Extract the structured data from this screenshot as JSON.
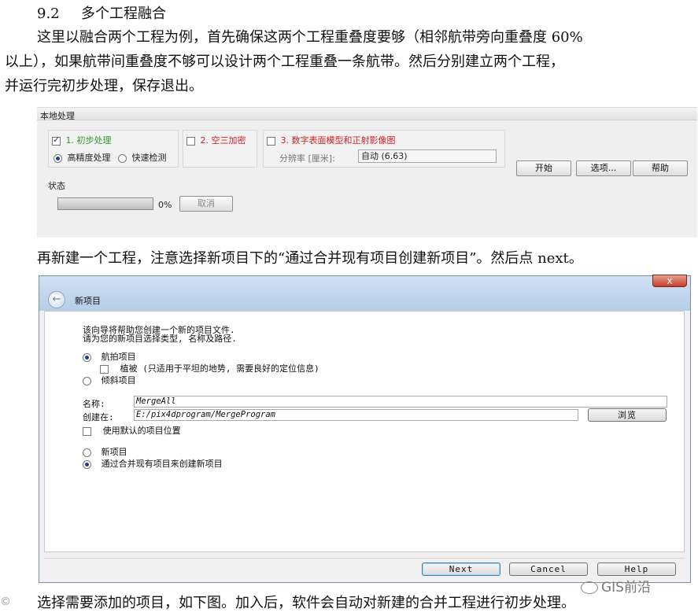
{
  "doc": {
    "heading_num": "9.2",
    "heading_text": "多个工程融合",
    "p1_line1": "这里以融合两个工程为例，首先确保这两个工程重叠度要够（相邻航带旁向重叠度 60%",
    "p1_line2": "以上），如果航带间重叠度不够可以设计两个工程重叠一条航带。然后分别建立两个工程，",
    "p1_line3": "并运行完初步处理，保存退出。",
    "p2": "再新建一个工程，注意选择新项目下的“通过合并现有项目创建新项目”。然后点 next。",
    "p3": "选择需要添加的项目，如下图。加入后，软件会自动对新建的合并工程进行初步处理。"
  },
  "local_processing": {
    "title": "本地处理",
    "step1_label": "1. 初步处理",
    "step1_checked": true,
    "mode_high": "高精度处理",
    "mode_fast": "快速检测",
    "mode_selected": "high",
    "step2_label": "2. 空三加密",
    "step2_checked": false,
    "step3_label": "3. 数字表面模型和正射影像图",
    "step3_checked": false,
    "resolution_label": "分辨率 [厘米]:",
    "resolution_value": "自动 (6.63)",
    "start_button": "开始",
    "options_button": "选项...",
    "help_button": "帮助",
    "status_label": "状态",
    "progress_text": "0%",
    "progress_value": 0,
    "cancel_button": "取消"
  },
  "new_project": {
    "title": "新项目",
    "close_symbol": "x",
    "back_symbol": "←",
    "intro_line1": "该向导将帮助您创建一个新的项目文件.",
    "intro_line2": "请为您的新项目选择类型, 名称及路径.",
    "type_aerial": "航拍项目",
    "type_aerial_selected": true,
    "vegetation_label": "植被 (只适用于平坦的地势, 需要良好的定位信息)",
    "vegetation_checked": false,
    "type_oblique": "倾斜项目",
    "name_label": "名称:",
    "name_value": "MergeAll",
    "create_in_label": "创建在:",
    "create_in_value": "E:/pix4dprogram/MergeProgram",
    "browse_button": "浏览",
    "default_location_label": "使用默认的项目位置",
    "default_location_checked": false,
    "opt_new_project": "新项目",
    "opt_merge_project": "通过合并现有项目来创建新项目",
    "merge_selected": true,
    "next_button": "Next",
    "cancel_button": "Cancel",
    "help_button": "Help"
  },
  "watermark": {
    "logo_text": "GIS前沿",
    "corner_text": "©"
  }
}
